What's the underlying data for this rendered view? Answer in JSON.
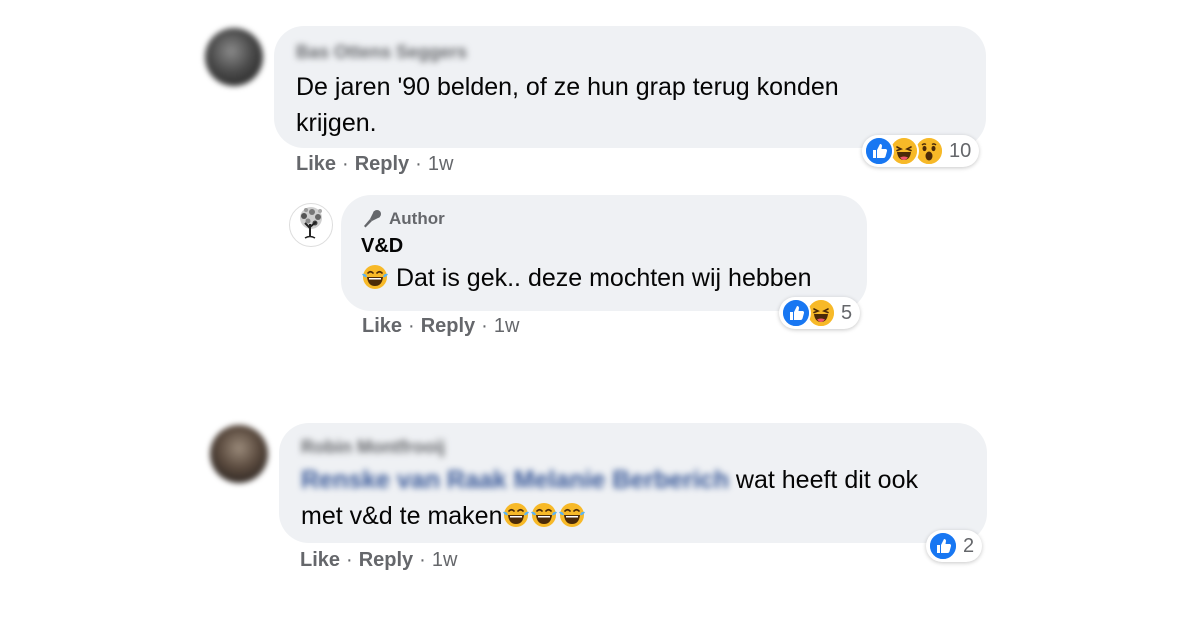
{
  "comments": [
    {
      "author": "Bas Ottens Seggers",
      "text": "De jaren '90 belden, of ze hun grap terug konden krijgen.",
      "actions": {
        "like": "Like",
        "reply": "Reply",
        "time": "1w",
        "sep": "·"
      },
      "reaction_count": "10",
      "reaction_icons": [
        "like-icon",
        "haha-icon",
        "wow-icon"
      ]
    },
    {
      "badge": "Author",
      "author": "V&D",
      "text": "Dat is gek.. deze mochten wij hebben",
      "actions": {
        "like": "Like",
        "reply": "Reply",
        "time": "1w",
        "sep": "·"
      },
      "reaction_count": "5",
      "reaction_icons": [
        "like-icon",
        "haha-icon"
      ]
    },
    {
      "author": "Robin Montfrooij",
      "tags": "Renske van Raak Melanie Berberich",
      "text": " wat heeft dit ook met v&d te maken",
      "actions": {
        "like": "Like",
        "reply": "Reply",
        "time": "1w",
        "sep": "·"
      },
      "reaction_count": "2",
      "reaction_icons": [
        "like-icon"
      ]
    }
  ],
  "colors": {
    "bubble": "#eff1f4",
    "secondary_text": "#65676b",
    "like_blue": "#1877f2",
    "emoji_yellow": "#f7b928"
  }
}
